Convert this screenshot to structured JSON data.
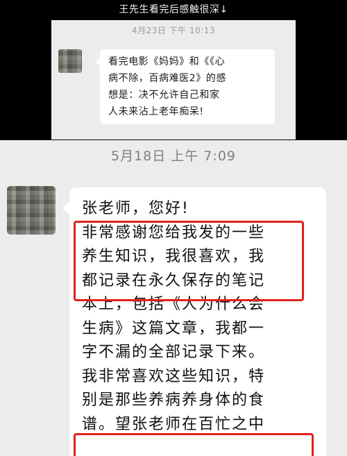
{
  "caption": "王先生看完后感触很深↓",
  "top_chat": {
    "timestamp": "4月23日 下午 10:13",
    "message_lines": [
      "看完电影《妈妈》和《《心",
      "病不除，百病难医2》的感",
      "想是：决不允许自己和家",
      "人未来沾上老年痴呆!"
    ]
  },
  "main_chat": {
    "timestamp": "5月18日 上午 7:09",
    "message_lines": [
      "张老师，您好!",
      "非常感谢您给我发的一些",
      "养生知识，我很喜欢，我",
      "都记录在永久保存的笔记",
      "本上，包括《人为什么会",
      "生病》这篇文章，我都一",
      "字不漏的全部记录下来。",
      "我非常喜欢这些知识，特",
      "别是那些养病养身体的食",
      "谱。望张老师在百忙之中"
    ]
  },
  "colors": {
    "highlight": "#e0221b",
    "chat_background": "#ececec",
    "bubble": "#ffffff"
  }
}
